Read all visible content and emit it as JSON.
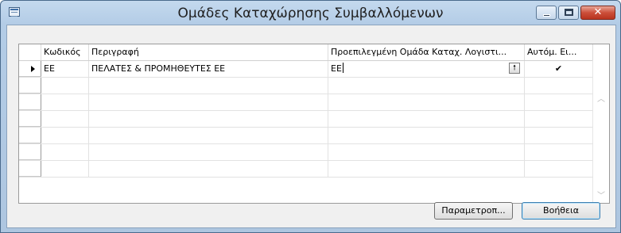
{
  "window": {
    "title": "Ομάδες Καταχώρησης Συμβαλλόμενων",
    "controls": {
      "minimize_icon": "minimize-icon",
      "maximize_icon": "maximize-icon",
      "close_glyph": "✕"
    }
  },
  "grid": {
    "columns": [
      {
        "label": "Κωδικός"
      },
      {
        "label": "Περιγραφή"
      },
      {
        "label": "Προεπιλεγμένη Ομάδα Καταχ. Λογιστι..."
      },
      {
        "label": "Αυτόμ. Ει..."
      }
    ],
    "rows": [
      {
        "code": "ΕΕ",
        "description": "ΠΕΛΑΤΕΣ & ΠΡΟΜΗΘΕΥΤΕΣ ΕΕ",
        "default_group": "ΕΕ",
        "auto": "✔"
      }
    ],
    "empty_rows": 6,
    "lookup_icon": "🠕"
  },
  "buttons": {
    "setup": "Παραμετροπ...",
    "help": "Βοήθεια"
  }
}
